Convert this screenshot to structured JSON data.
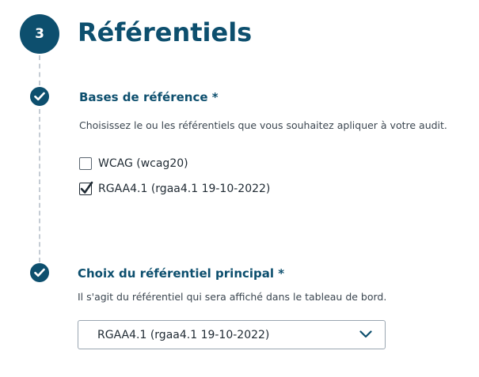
{
  "step": {
    "number": "3",
    "title": "Référentiels"
  },
  "bases": {
    "title": "Bases de référence *",
    "help": "Choisissez le ou les référentiels que vous souhaitez apliquer à votre audit.",
    "options": [
      {
        "label": "WCAG (wcag20)",
        "checked": false
      },
      {
        "label": "RGAA4.1 (rgaa4.1 19-10-2022)",
        "checked": true
      }
    ]
  },
  "principal": {
    "title": "Choix du référentiel principal *",
    "help": "Il s'agit du référentiel qui sera affiché dans le tableau de bord.",
    "selected": "RGAA4.1 (rgaa4.1 19-10-2022)"
  },
  "colors": {
    "accent": "#0d4f6e",
    "border": "#9aa6b1",
    "dashed_line": "#c5ccd4"
  },
  "icons": {
    "step_check": "check-icon",
    "select_chevron": "chevron-down-icon"
  }
}
